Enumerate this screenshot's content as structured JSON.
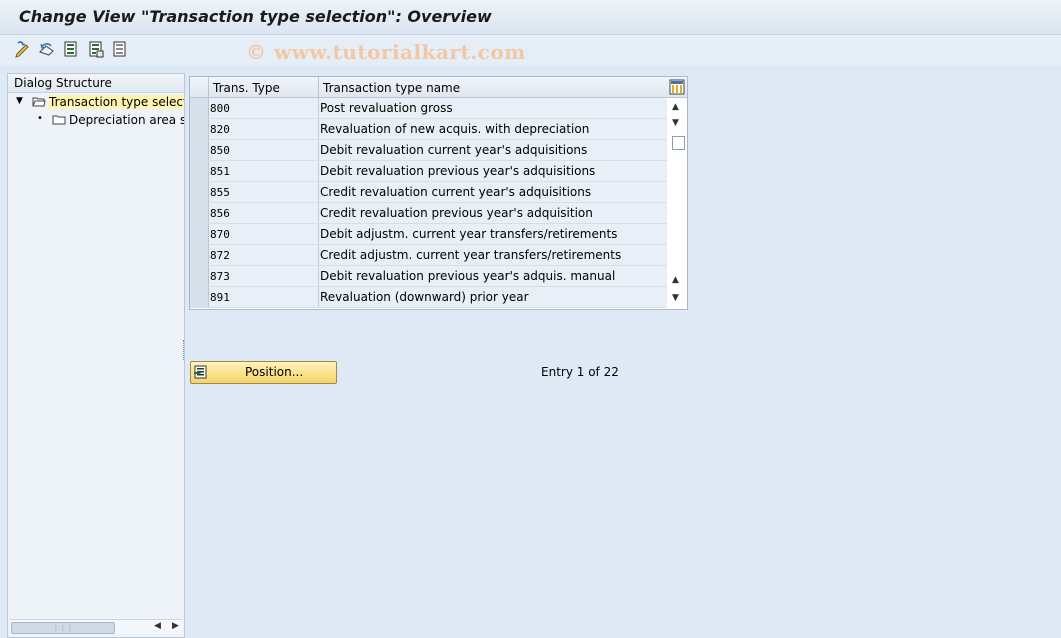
{
  "window": {
    "title": "Change View \"Transaction type selection\": Overview"
  },
  "toolbar": {
    "buttons": [
      {
        "icon": "display-change-icon"
      },
      {
        "icon": "undo-icon"
      },
      {
        "icon": "select-all-icon"
      },
      {
        "icon": "select-block-icon"
      },
      {
        "icon": "deselect-all-icon"
      }
    ]
  },
  "watermark": "© www.tutorialkart.com",
  "dialog_structure": {
    "header": "Dialog Structure",
    "items": [
      {
        "label": "Transaction type selection",
        "level": 0,
        "expanded": true,
        "selected": true
      },
      {
        "label": "Depreciation area specification",
        "level": 1,
        "expanded": false,
        "selected": false
      }
    ]
  },
  "table": {
    "columns": [
      "Trans. Type",
      "Transaction type name"
    ],
    "rows": [
      {
        "code": "800",
        "name": "Post revaluation gross"
      },
      {
        "code": "820",
        "name": "Revaluation of new acquis. with depreciation"
      },
      {
        "code": "850",
        "name": "Debit revaluation current year's adquisitions"
      },
      {
        "code": "851",
        "name": "Debit revaluation previous year's adquisitions"
      },
      {
        "code": "855",
        "name": "Credit revaluation current year's adquisitions"
      },
      {
        "code": "856",
        "name": "Credit revaluation previous year's adquisition"
      },
      {
        "code": "870",
        "name": "Debit adjustm. current year transfers/retirements"
      },
      {
        "code": "872",
        "name": "Credit adjustm. current year transfers/retirements"
      },
      {
        "code": "873",
        "name": "Debit revaluation previous year's adquis. manual"
      },
      {
        "code": "891",
        "name": "Revaluation (downward) prior year"
      }
    ]
  },
  "footer": {
    "position_label": "Position...",
    "entry_text": "Entry 1 of 22"
  },
  "colors": {
    "background": "#dfe9f5",
    "selection": "#fff3b0",
    "button_yellow": "#f4d56a"
  }
}
